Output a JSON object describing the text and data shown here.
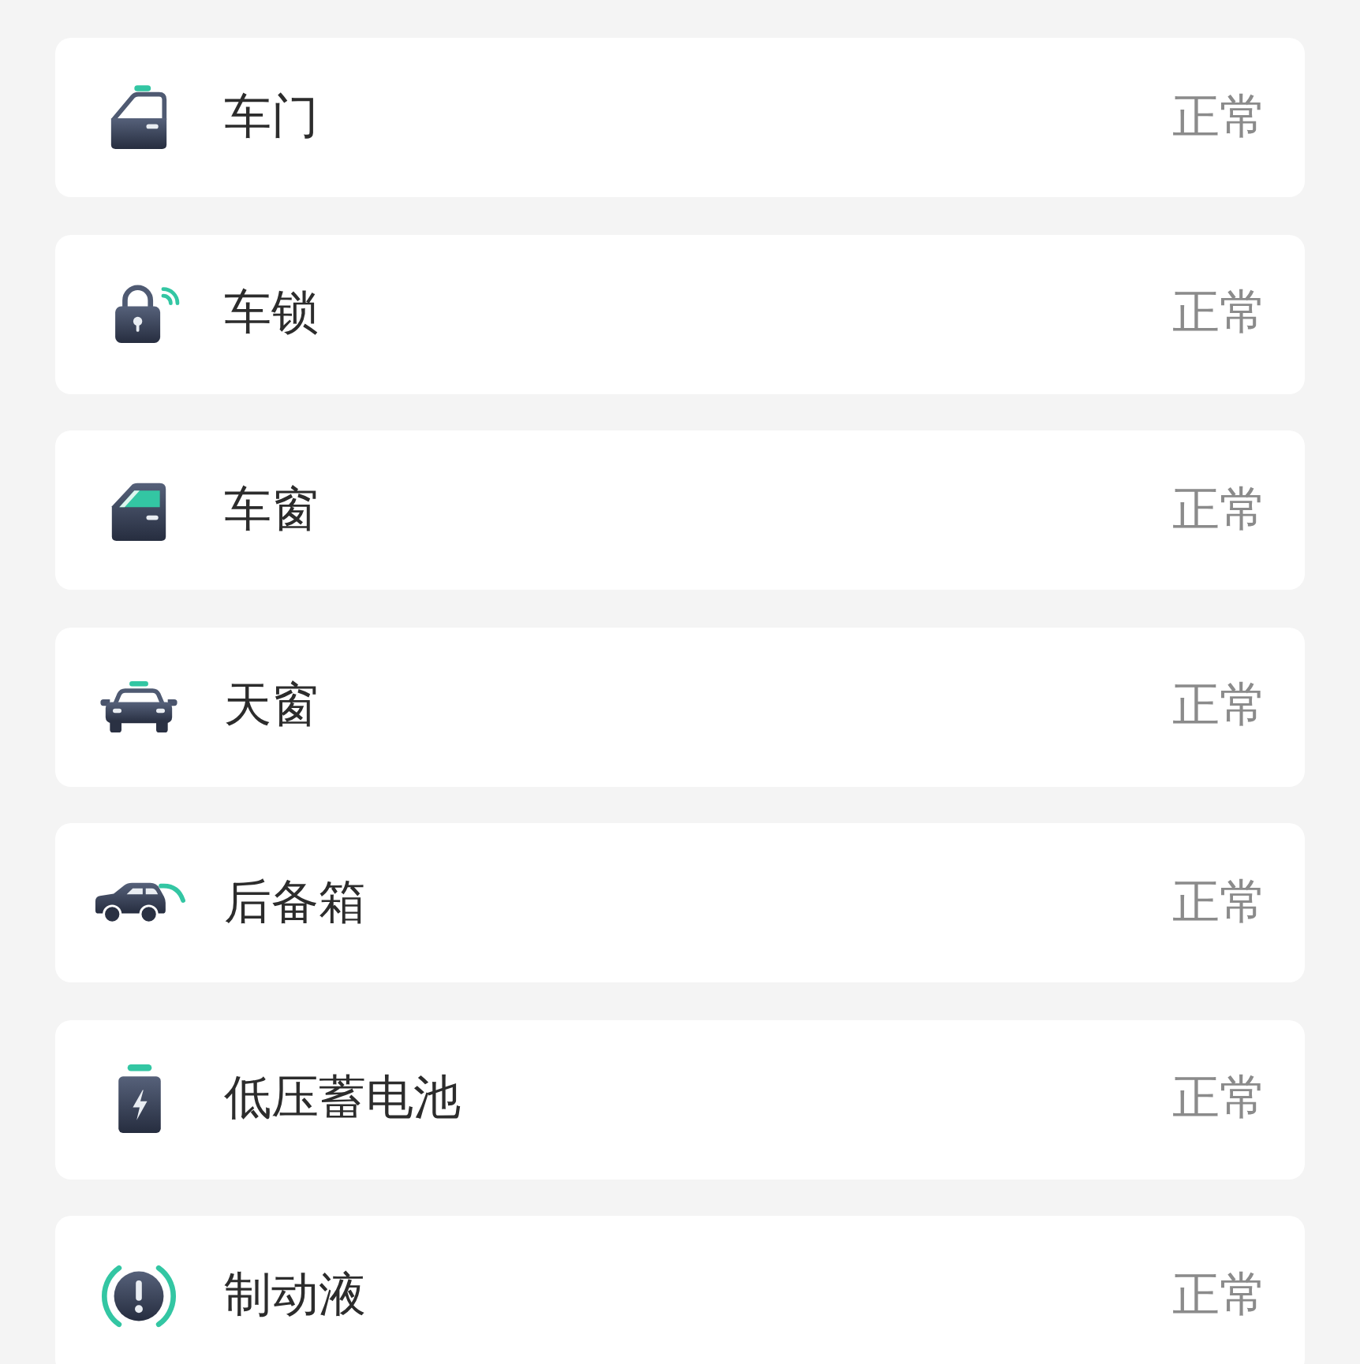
{
  "items": [
    {
      "kind": "door",
      "label": "车门",
      "status": "正常"
    },
    {
      "kind": "lock",
      "label": "车锁",
      "status": "正常"
    },
    {
      "kind": "window",
      "label": "车窗",
      "status": "正常"
    },
    {
      "kind": "sunroof",
      "label": "天窗",
      "status": "正常"
    },
    {
      "kind": "trunk",
      "label": "后备箱",
      "status": "正常"
    },
    {
      "kind": "battery",
      "label": "低压蓄电池",
      "status": "正常"
    },
    {
      "kind": "brake_fluid",
      "label": "制动液",
      "status": "正常"
    }
  ]
}
